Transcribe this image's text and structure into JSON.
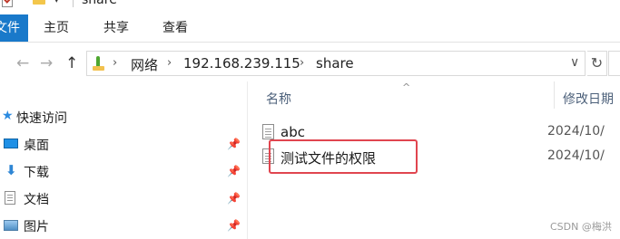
{
  "window": {
    "title": "share"
  },
  "ribbon": {
    "file_tab": "文件",
    "tabs": [
      "主页",
      "共享",
      "查看"
    ]
  },
  "address_bar": {
    "back_glyph": "←",
    "forward_glyph": "→",
    "up_glyph": "↑",
    "breadcrumb": [
      "网络",
      "192.168.239.115",
      "share"
    ],
    "separator_glyph": "›",
    "dropdown_glyph": "∨",
    "refresh_glyph": "↻"
  },
  "sidebar": {
    "quick_access": "快速访问",
    "items": [
      {
        "label": "桌面",
        "icon": "desktop-icon",
        "pinned": true
      },
      {
        "label": "下载",
        "icon": "download-icon",
        "pinned": true
      },
      {
        "label": "文档",
        "icon": "document-icon",
        "pinned": true
      },
      {
        "label": "图片",
        "icon": "picture-icon",
        "pinned": true
      }
    ],
    "pin_glyph": "📌"
  },
  "file_list": {
    "columns": {
      "name": "名称",
      "modified": "修改日期"
    },
    "sort_glyph": "^",
    "rows": [
      {
        "name": "abc",
        "modified": "2024/10/"
      },
      {
        "name": "测试文件的权限",
        "modified": "2024/10/"
      }
    ]
  },
  "watermark": "CSDN @梅洪",
  "colors": {
    "accent": "#1979ca",
    "highlight_border": "#e0454f"
  }
}
